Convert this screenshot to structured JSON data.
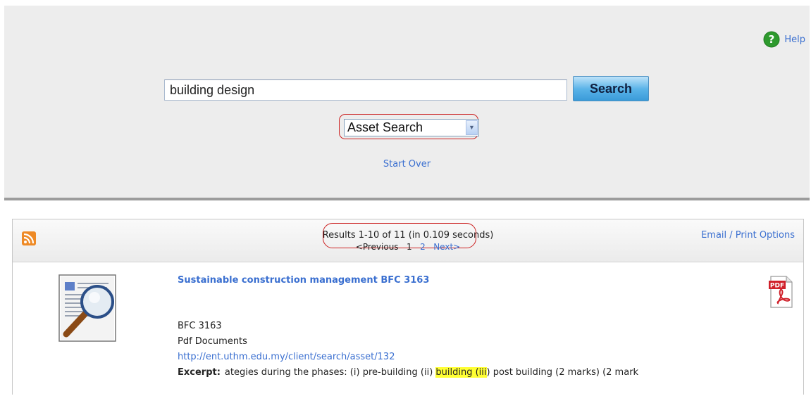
{
  "help": {
    "label": "Help"
  },
  "search": {
    "query": "building design",
    "button_label": "Search",
    "scope_selected": "Asset Search",
    "start_over": "Start Over"
  },
  "results_header": {
    "count_text": "Results 1-10 of 11 (in 0.109 seconds)",
    "pager": {
      "previous": "<Previous",
      "page1": "1",
      "page2": "2",
      "next": "Next>"
    },
    "email_print": "Email / Print Options"
  },
  "result": {
    "title": "Sustainable construction management BFC 3163",
    "code": "BFC 3163",
    "type": "Pdf Documents",
    "url": "http://ent.uthm.edu.my/client/search/asset/132",
    "excerpt_label": "Excerpt:",
    "excerpt_before": "ategies during the phases: (i) pre-building (ii) ",
    "excerpt_highlight": "building (iii",
    "excerpt_after": ") post building (2 marks) (2 mark"
  },
  "colors": {
    "link": "#3a6fd0",
    "highlight": "#ffff33",
    "annotation_oval": "#cc2222",
    "search_button": "#5ab3e8"
  },
  "icons": [
    "help-icon",
    "rss-icon",
    "document-magnifier-icon",
    "pdf-icon",
    "chevron-down-icon"
  ]
}
